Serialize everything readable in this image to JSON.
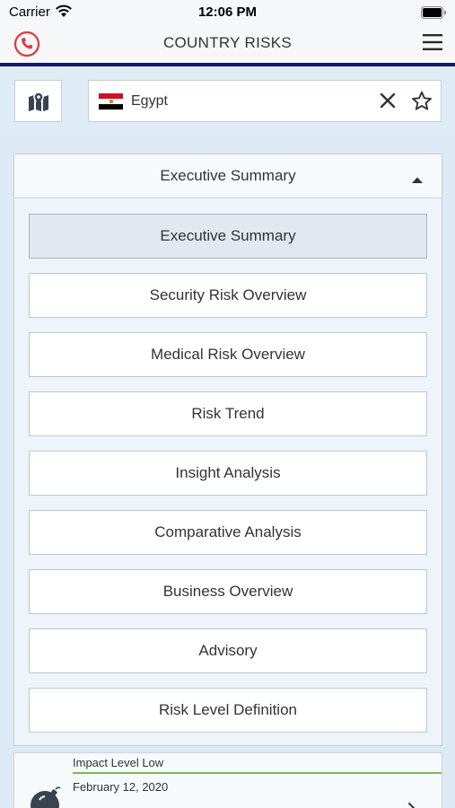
{
  "status_bar": {
    "carrier": "Carrier",
    "time": "12:06 PM"
  },
  "nav": {
    "title": "COUNTRY RISKS"
  },
  "search": {
    "country": "Egypt",
    "flag_colors": [
      "#ce1126",
      "#ffffff",
      "#000000"
    ]
  },
  "panel": {
    "header_label": "Executive Summary",
    "items": [
      {
        "label": "Executive Summary",
        "selected": true
      },
      {
        "label": "Security Risk Overview",
        "selected": false
      },
      {
        "label": "Medical Risk Overview",
        "selected": false
      },
      {
        "label": "Risk Trend",
        "selected": false
      },
      {
        "label": "Insight Analysis",
        "selected": false
      },
      {
        "label": "Comparative Analysis",
        "selected": false
      },
      {
        "label": "Business Overview",
        "selected": false
      },
      {
        "label": "Advisory",
        "selected": false
      },
      {
        "label": "Risk Level Definition",
        "selected": false
      }
    ]
  },
  "news": {
    "impact": "Impact Level Low",
    "date": "February 12, 2020",
    "impact_color": "#6fc14b"
  },
  "icons": [
    "wifi-icon",
    "battery-icon",
    "phone-icon",
    "hamburger-menu-icon",
    "map-icon",
    "egypt-flag-icon",
    "clear-icon",
    "star-icon",
    "caret-up-icon",
    "bomb-icon",
    "chevron-right-icon"
  ]
}
